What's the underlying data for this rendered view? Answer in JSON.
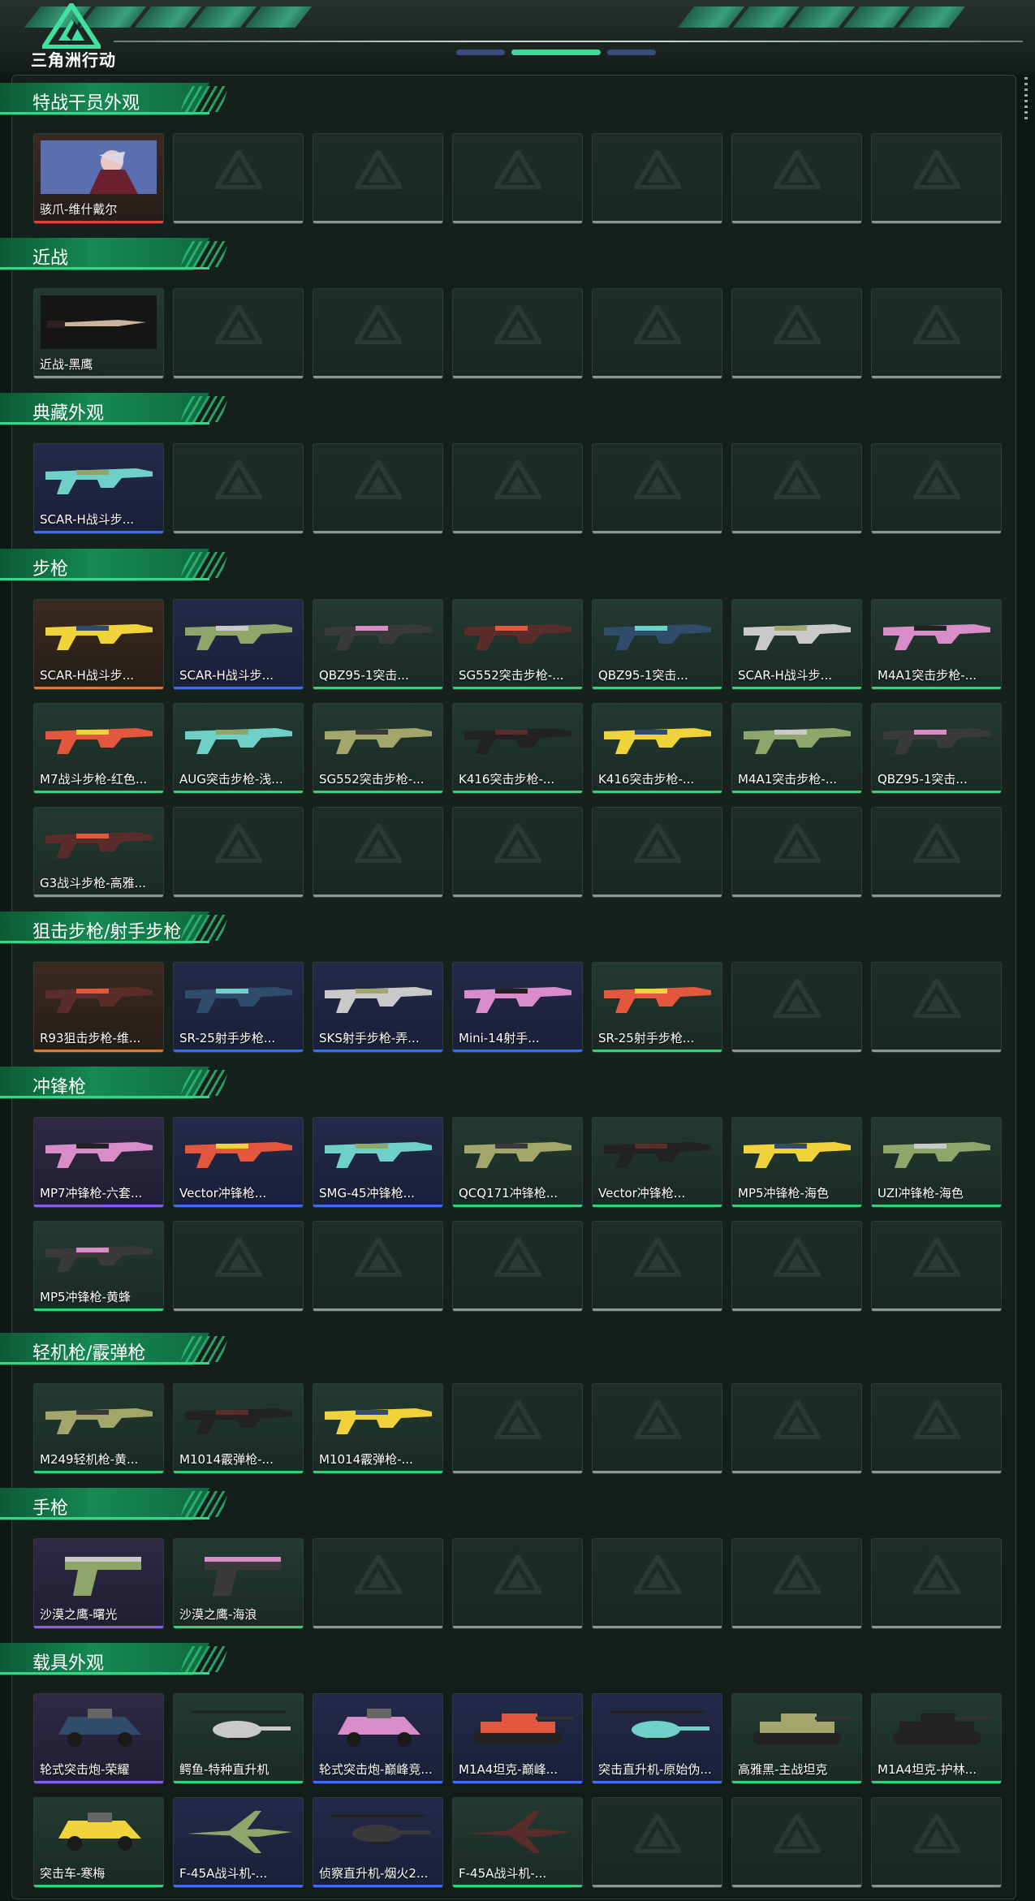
{
  "header": {
    "logo_text": "三角洲行动"
  },
  "colors": {
    "accent": "#38d488",
    "rarity_red": "#e0453a",
    "rarity_orange": "#e07a2a",
    "rarity_purple": "#8a5cf0",
    "rarity_blue": "#3a6ff0",
    "rarity_green": "#3ad07a",
    "empty": "#8c9792"
  },
  "sections": [
    {
      "title": "特战干员外观",
      "items": [
        {
          "label": "骇爪-维什戴尔",
          "rarity": "red",
          "icon": "operator-portrait-icon"
        }
      ]
    },
    {
      "title": "近战",
      "items": [
        {
          "label": "近战-黑鹰",
          "rarity": "empty-bar",
          "icon": "knife-icon"
        }
      ]
    },
    {
      "title": "典藏外观",
      "items": [
        {
          "label": "SCAR-H战斗步...",
          "rarity": "blue",
          "icon": "rifle-icon"
        }
      ]
    },
    {
      "title": "步枪",
      "items": [
        {
          "label": "SCAR-H战斗步...",
          "rarity": "orange",
          "icon": "rifle-icon"
        },
        {
          "label": "SCAR-H战斗步...",
          "rarity": "blue",
          "icon": "rifle-icon"
        },
        {
          "label": "QBZ95-1突击...",
          "rarity": "green",
          "icon": "bullpup-rifle-icon"
        },
        {
          "label": "SG552突击步枪-...",
          "rarity": "green",
          "icon": "rifle-icon"
        },
        {
          "label": "QBZ95-1突击...",
          "rarity": "green",
          "icon": "bullpup-rifle-icon"
        },
        {
          "label": "SCAR-H战斗步...",
          "rarity": "green",
          "icon": "rifle-icon"
        },
        {
          "label": "M4A1突击步枪-...",
          "rarity": "green",
          "icon": "rifle-icon"
        },
        {
          "label": "M7战斗步枪-红色...",
          "rarity": "green",
          "icon": "rifle-icon"
        },
        {
          "label": "AUG突击步枪-浅...",
          "rarity": "green",
          "icon": "bullpup-rifle-icon"
        },
        {
          "label": "SG552突击步枪-...",
          "rarity": "green",
          "icon": "rifle-icon"
        },
        {
          "label": "K416突击步枪-...",
          "rarity": "green",
          "icon": "rifle-icon"
        },
        {
          "label": "K416突击步枪-...",
          "rarity": "green",
          "icon": "rifle-icon"
        },
        {
          "label": "M4A1突击步枪-...",
          "rarity": "green",
          "icon": "rifle-icon"
        },
        {
          "label": "QBZ95-1突击...",
          "rarity": "green",
          "icon": "bullpup-rifle-icon"
        },
        {
          "label": "G3战斗步枪-高雅...",
          "rarity": "empty-bar",
          "icon": "rifle-icon"
        }
      ]
    },
    {
      "title": "狙击步枪/射手步枪",
      "items": [
        {
          "label": "R93狙击步枪-维...",
          "rarity": "orange",
          "icon": "sniper-rifle-icon"
        },
        {
          "label": "SR-25射手步枪...",
          "rarity": "blue",
          "icon": "sniper-rifle-icon"
        },
        {
          "label": "SKS射手步枪-弄...",
          "rarity": "blue",
          "icon": "sniper-rifle-icon"
        },
        {
          "label": "Mini-14射手...",
          "rarity": "blue",
          "icon": "sniper-rifle-icon"
        },
        {
          "label": "SR-25射手步枪...",
          "rarity": "green",
          "icon": "sniper-rifle-icon"
        }
      ]
    },
    {
      "title": "冲锋枪",
      "items": [
        {
          "label": "MP7冲锋枪-六套...",
          "rarity": "purple",
          "icon": "smg-icon"
        },
        {
          "label": "Vector冲锋枪...",
          "rarity": "blue",
          "icon": "smg-icon"
        },
        {
          "label": "SMG-45冲锋枪...",
          "rarity": "blue",
          "icon": "smg-icon"
        },
        {
          "label": "QCQ171冲锋枪...",
          "rarity": "green",
          "icon": "smg-icon"
        },
        {
          "label": "Vector冲锋枪...",
          "rarity": "green",
          "icon": "smg-icon"
        },
        {
          "label": "MP5冲锋枪-海色",
          "rarity": "green",
          "icon": "smg-icon"
        },
        {
          "label": "UZI冲锋枪-海色",
          "rarity": "green",
          "icon": "smg-icon"
        },
        {
          "label": "MP5冲锋枪-黄蜂",
          "rarity": "green",
          "icon": "smg-icon"
        }
      ]
    },
    {
      "title": "轻机枪/霰弹枪",
      "items": [
        {
          "label": "M249轻机枪-黄...",
          "rarity": "green",
          "icon": "machine-gun-icon"
        },
        {
          "label": "M1014霰弹枪-...",
          "rarity": "green",
          "icon": "shotgun-icon"
        },
        {
          "label": "M1014霰弹枪-...",
          "rarity": "green",
          "icon": "shotgun-icon"
        }
      ]
    },
    {
      "title": "手枪",
      "items": [
        {
          "label": "沙漠之鹰-曙光",
          "rarity": "purple",
          "icon": "pistol-icon"
        },
        {
          "label": "沙漠之鹰-海浪",
          "rarity": "green",
          "icon": "pistol-icon"
        }
      ]
    },
    {
      "title": "载具外观",
      "items": [
        {
          "label": "轮式突击炮-荣耀",
          "rarity": "purple",
          "icon": "armored-vehicle-icon"
        },
        {
          "label": "鳄鱼-特种直升机",
          "rarity": "green",
          "icon": "helicopter-icon"
        },
        {
          "label": "轮式突击炮-巅峰竞...",
          "rarity": "blue",
          "icon": "armored-vehicle-icon"
        },
        {
          "label": "M1A4坦克-巅峰...",
          "rarity": "blue",
          "icon": "tank-icon"
        },
        {
          "label": "突击直升机-原始伪...",
          "rarity": "blue",
          "icon": "helicopter-icon"
        },
        {
          "label": "高雅黑-主战坦克",
          "rarity": "green",
          "icon": "tank-icon"
        },
        {
          "label": "M1A4坦克-护林...",
          "rarity": "green",
          "icon": "tank-icon"
        },
        {
          "label": "突击车-寒梅",
          "rarity": "green",
          "icon": "armored-vehicle-icon"
        },
        {
          "label": "F-45A战斗机-...",
          "rarity": "blue",
          "icon": "fighter-jet-icon"
        },
        {
          "label": "侦察直升机-烟火2...",
          "rarity": "blue",
          "icon": "helicopter-icon"
        },
        {
          "label": "F-45A战斗机-...",
          "rarity": "green",
          "icon": "fighter-jet-icon"
        }
      ]
    }
  ]
}
